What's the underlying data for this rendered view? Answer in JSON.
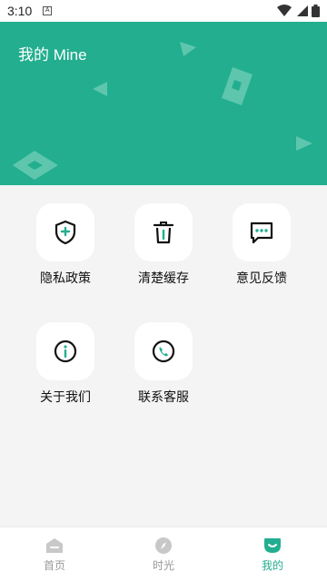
{
  "status_bar": {
    "time": "3:10",
    "notification_letter": "A"
  },
  "header": {
    "title": "我的 Mine"
  },
  "menu": [
    {
      "label": "隐私政策",
      "icon": "shield-plus-icon"
    },
    {
      "label": "清楚缓存",
      "icon": "trash-icon"
    },
    {
      "label": "意见反馈",
      "icon": "message-dots-icon"
    },
    {
      "label": "关于我们",
      "icon": "info-icon"
    },
    {
      "label": "联系客服",
      "icon": "phone-icon"
    }
  ],
  "tabs": [
    {
      "label": "首页",
      "icon": "home-icon",
      "active": false
    },
    {
      "label": "时光",
      "icon": "compass-icon",
      "active": false
    },
    {
      "label": "我的",
      "icon": "face-icon",
      "active": true
    }
  ],
  "colors": {
    "accent": "#22ae8f",
    "background": "#f4f4f4",
    "tab_inactive": "#999999"
  }
}
